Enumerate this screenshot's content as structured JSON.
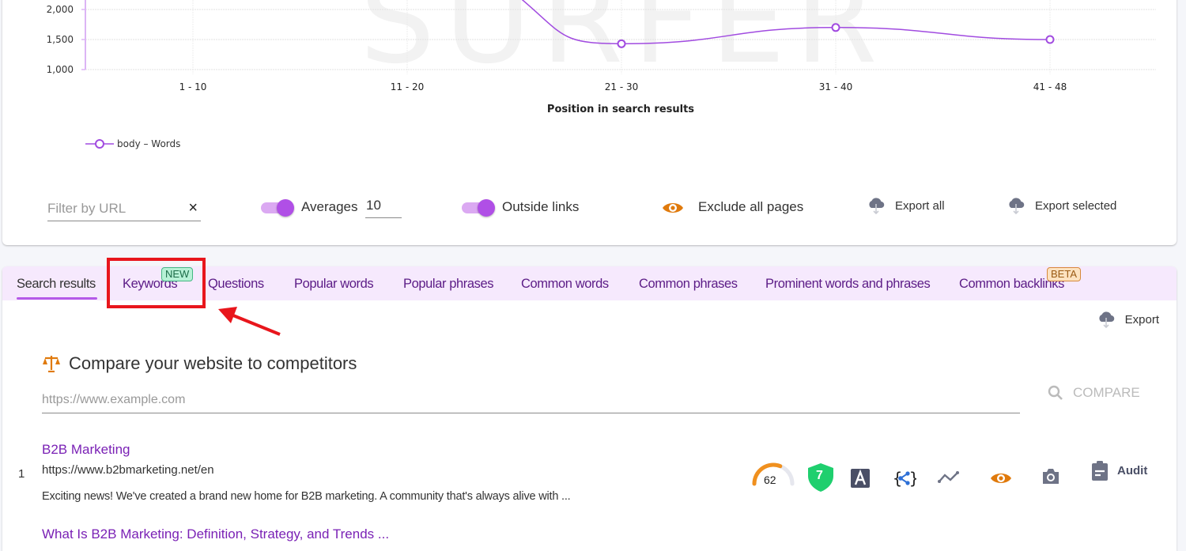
{
  "chart_data": {
    "type": "line",
    "title": "",
    "xlabel": "Position in search results",
    "ylabel": "",
    "categories": [
      "1 - 10",
      "11 - 20",
      "21 - 30",
      "31 - 40",
      "41 - 48"
    ],
    "series": [
      {
        "name": "body – Words",
        "values": [
          null,
          null,
          1430,
          1700,
          1500
        ],
        "color": "#a14be0"
      }
    ],
    "y_ticks": [
      "1,000",
      "1,500",
      "2,000"
    ],
    "ylim_visible": [
      1000,
      2000
    ],
    "grid": true,
    "legend": "bottom-left",
    "watermark": "SURFER"
  },
  "controls": {
    "filter_placeholder": "Filter by URL",
    "filter_value": "",
    "clear_icon": "×",
    "averages_label": "Averages",
    "averages_on": true,
    "averages_value": "10",
    "outside_links_label": "Outside links",
    "outside_links_on": true,
    "exclude_label": "Exclude all pages",
    "export_all_label": "Export all",
    "export_selected_label": "Export selected"
  },
  "tabs": [
    {
      "label": "Search results",
      "active": true
    },
    {
      "label": "Keywords",
      "badge": "NEW"
    },
    {
      "label": "Questions"
    },
    {
      "label": "Popular words"
    },
    {
      "label": "Popular phrases"
    },
    {
      "label": "Common words"
    },
    {
      "label": "Common phrases"
    },
    {
      "label": "Prominent words and phrases"
    },
    {
      "label": "Common backlinks",
      "badge": "BETA"
    }
  ],
  "export_label": "Export",
  "compare": {
    "title": "Compare your website to competitors",
    "placeholder": "https://www.example.com",
    "button_label": "COMPARE"
  },
  "results": [
    {
      "rank": "1",
      "title": "B2B Marketing",
      "url": "https://www.b2bmarketing.net/en",
      "description": "Exciting news! We've created a brand new home for B2B marketing. A community that's always alive with ...",
      "content_score": "62",
      "content_score_fraction": 0.62,
      "security_score": "7",
      "audit_label": "Audit"
    },
    {
      "title": "What Is B2B Marketing: Definition, Strategy, and Trends ..."
    }
  ],
  "colors": {
    "accent": "#b04fe6",
    "tab_text": "#5b1b86",
    "link": "#7a21b5",
    "eye": "#e07a0c",
    "annotation": "#e8161c"
  }
}
